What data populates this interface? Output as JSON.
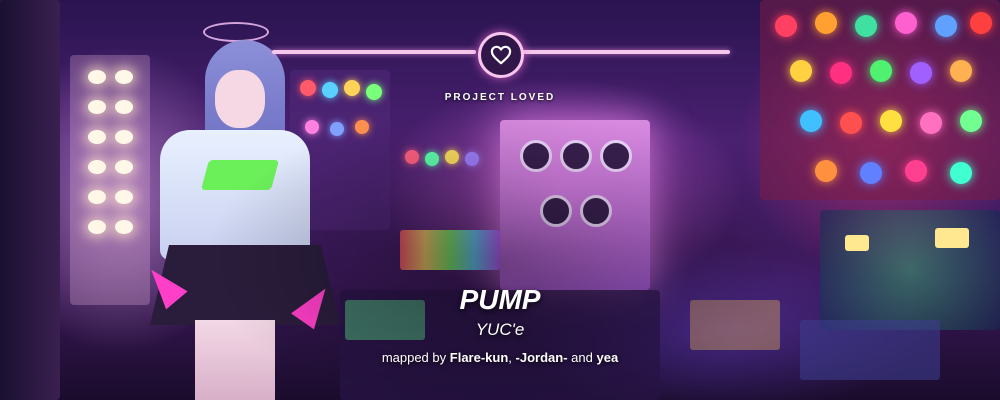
{
  "banner": {
    "label": "PROJECT LOVED",
    "icon": "heart-icon",
    "accent_color": "#f4c8ec"
  },
  "beatmap": {
    "title": "PUMP",
    "artist": "YUC'e",
    "mapped_by_prefix": "mapped by",
    "mappers": [
      "Flare-kun",
      "-Jordan-",
      "yea"
    ],
    "separator_comma": ",",
    "separator_and": "and"
  }
}
